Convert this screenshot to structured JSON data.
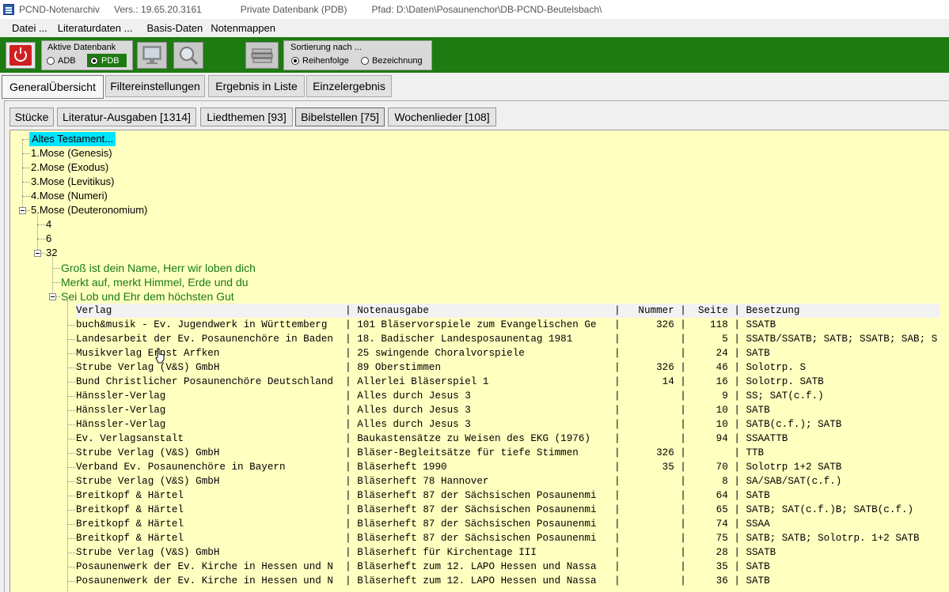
{
  "titlebar": {
    "app_name": "PCND-Notenarchiv",
    "version": "Vers.: 19.65.20.3161",
    "db_type": "Private Datenbank (PDB)",
    "path": "Pfad: D:\\Daten\\Posaunenchor\\DB-PCND-Beutelsbach\\"
  },
  "menu": [
    "Datei ...",
    "Literaturdaten ...",
    "Basis-Daten",
    "Notenmappen"
  ],
  "toolbar": {
    "db_group_label": "Aktive Datenbank",
    "db_options": [
      "ADB",
      "PDB"
    ],
    "db_selected": "PDB",
    "sort_group_label": "Sortierung nach ...",
    "sort_options": [
      "Reihenfolge",
      "Bezeichnung"
    ],
    "sort_selected": "Reihenfolge",
    "accent_color": "#1e7b12",
    "icons": [
      "power-icon",
      "monitor-icon",
      "search-icon",
      "books-icon"
    ]
  },
  "main_tabs": [
    "GeneralÜbersicht",
    "Filtereinstellungen",
    "Ergebnis in Liste",
    "Einzelergebnis"
  ],
  "sub_tabs": [
    "Stücke",
    "Literatur-Ausgaben [1314]",
    "Liedthemen [93]",
    "Bibelstellen [75]",
    "Wochenlieder [108]"
  ],
  "sub_tab_active": "Bibelstellen [75]",
  "tree": {
    "root": "Altes Testament...",
    "books": [
      "1.Mose (Genesis)",
      "2.Mose (Exodus)",
      "3.Mose (Levitikus)",
      "4.Mose (Numeri)",
      "5.Mose (Deuteronomium)"
    ],
    "chapters": [
      "4",
      "6",
      "32"
    ],
    "songs": [
      "Groß ist dein Name, Herr wir loben dich",
      "Merkt auf, merkt Himmel, Erde und du",
      "Sei Lob und Ehr dem höchsten Gut"
    ]
  },
  "table": {
    "columns": [
      "Verlag",
      "Notenausgabe",
      "Nummer",
      "Seite",
      "Besetzung"
    ],
    "rows": [
      [
        "buch&musik - Ev. Jugendwerk in Württemberg",
        "101 Bläservorspiele zum Evangelischen Ge",
        "326",
        "118",
        "SSATB"
      ],
      [
        "Landesarbeit der Ev. Posaunenchöre in Baden",
        "18. Badischer Landesposaunentag 1981",
        "",
        "5",
        "SSATB/SSATB; SATB; SSATB; SAB; S"
      ],
      [
        "Musikverlag Ernst Arfken",
        "25 swingende Choralvorspiele",
        "",
        "24",
        "SATB"
      ],
      [
        "Strube Verlag (V&S) GmbH",
        "89 Oberstimmen",
        "326",
        "46",
        "Solotrp. S"
      ],
      [
        "Bund Christlicher Posaunenchöre Deutschland",
        "Allerlei Bläserspiel 1",
        "14",
        "16",
        "Solotrp. SATB"
      ],
      [
        "Hänssler-Verlag",
        "Alles durch Jesus 3",
        "",
        "9",
        "SS; SAT(c.f.)"
      ],
      [
        "Hänssler-Verlag",
        "Alles durch Jesus 3",
        "",
        "10",
        "SATB"
      ],
      [
        "Hänssler-Verlag",
        "Alles durch Jesus 3",
        "",
        "10",
        "SATB(c.f.); SATB"
      ],
      [
        "Ev. Verlagsanstalt",
        "Baukastensätze zu Weisen des EKG (1976)",
        "",
        "94",
        "SSAATTB"
      ],
      [
        "Strube Verlag (V&S) GmbH",
        "Bläser-Begleitsätze für tiefe Stimmen",
        "326",
        "",
        "TTB"
      ],
      [
        "Verband Ev. Posaunenchöre in Bayern",
        "Bläserheft 1990",
        "35",
        "70",
        "Solotrp 1+2 SATB"
      ],
      [
        "Strube Verlag (V&S) GmbH",
        "Bläserheft 78 Hannover",
        "",
        "8",
        "SA/SAB/SAT(c.f.)"
      ],
      [
        "Breitkopf & Härtel",
        "Bläserheft 87 der Sächsischen Posaunenmi",
        "",
        "64",
        "SATB"
      ],
      [
        "Breitkopf & Härtel",
        "Bläserheft 87 der Sächsischen Posaunenmi",
        "",
        "65",
        "SATB; SAT(c.f.)B; SATB(c.f.)"
      ],
      [
        "Breitkopf & Härtel",
        "Bläserheft 87 der Sächsischen Posaunenmi",
        "",
        "74",
        "SSAA"
      ],
      [
        "Breitkopf & Härtel",
        "Bläserheft 87 der Sächsischen Posaunenmi",
        "",
        "75",
        "SATB; SATB; Solotrp. 1+2 SATB"
      ],
      [
        "Strube Verlag (V&S) GmbH",
        "Bläserheft für Kirchentage III",
        "",
        "28",
        "SSATB"
      ],
      [
        "Posaunenwerk der Ev. Kirche in Hessen und N",
        "Bläserheft zum 12. LAPO Hessen und Nassa",
        "",
        "35",
        "SATB"
      ],
      [
        "Posaunenwerk der Ev. Kirche in Hessen und N",
        "Bläserheft zum 12. LAPO Hessen und Nassa",
        "",
        "36",
        "SATB"
      ]
    ]
  }
}
